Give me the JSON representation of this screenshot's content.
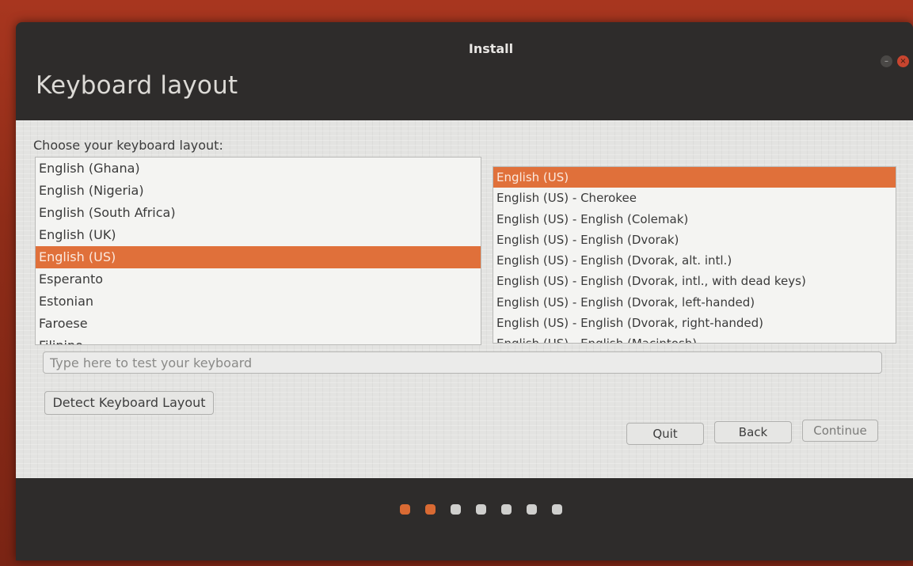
{
  "window": {
    "title": "Install",
    "controls": {
      "minimize_glyph": "–",
      "close_glyph": "×"
    }
  },
  "page": {
    "title": "Keyboard layout",
    "choose_label": "Choose your keyboard layout:"
  },
  "layouts": {
    "selected_index": 4,
    "items": [
      "English (Ghana)",
      "English (Nigeria)",
      "English (South Africa)",
      "English (UK)",
      "English (US)",
      "Esperanto",
      "Estonian",
      "Faroese",
      "Filipino"
    ]
  },
  "variants": {
    "selected_index": 0,
    "items": [
      "English (US)",
      "English (US) - Cherokee",
      "English (US) - English (Colemak)",
      "English (US) - English (Dvorak)",
      "English (US) - English (Dvorak, alt. intl.)",
      "English (US) - English (Dvorak, intl., with dead keys)",
      "English (US) - English (Dvorak, left-handed)",
      "English (US) - English (Dvorak, right-handed)",
      "English (US) - English (Macintosh)"
    ]
  },
  "test_input": {
    "value": "",
    "placeholder": "Type here to test your keyboard"
  },
  "buttons": {
    "detect": "Detect Keyboard Layout",
    "quit": "Quit",
    "back": "Back",
    "continue": "Continue"
  },
  "progress": {
    "total_steps": 7,
    "completed_steps": 2
  },
  "colors": {
    "accent": "#e0703a",
    "titlebar": "#2e2c2b",
    "close": "#c8452f"
  }
}
